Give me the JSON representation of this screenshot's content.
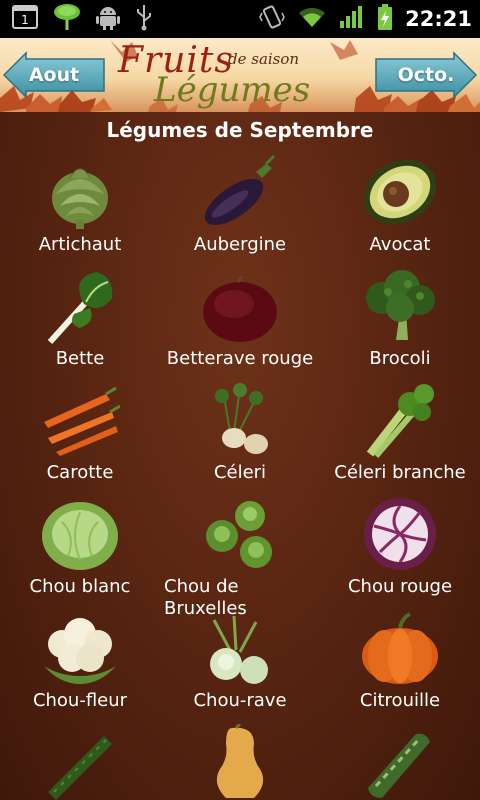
{
  "status_bar": {
    "time": "22:21",
    "notification_count": "1",
    "left_icons": [
      "notification-badge-icon",
      "plant-icon",
      "android-icon",
      "usb-icon"
    ],
    "right_icons": [
      "vibrate-icon",
      "wifi-icon",
      "signal-icon",
      "battery-charging-icon"
    ]
  },
  "header": {
    "logo_line1": "Fruits",
    "logo_small": "de saison",
    "logo_line2": "Légumes",
    "prev_label": "Aout",
    "next_label": "Octo.",
    "accent_color": "#4a9fb3"
  },
  "main": {
    "title": "Légumes de Septembre",
    "items": [
      {
        "label": "Artichaut",
        "icon": "artichoke-icon"
      },
      {
        "label": "Aubergine",
        "icon": "eggplant-icon"
      },
      {
        "label": "Avocat",
        "icon": "avocado-icon"
      },
      {
        "label": "Bette",
        "icon": "chard-icon"
      },
      {
        "label": "Betterave rouge",
        "icon": "beetroot-icon"
      },
      {
        "label": "Brocoli",
        "icon": "broccoli-icon"
      },
      {
        "label": "Carotte",
        "icon": "carrot-icon"
      },
      {
        "label": "Céleri",
        "icon": "celeriac-icon"
      },
      {
        "label": "Céleri branche",
        "icon": "celery-icon"
      },
      {
        "label": "Chou blanc",
        "icon": "white-cabbage-icon"
      },
      {
        "label": "Chou de Bruxelles",
        "icon": "brussels-sprouts-icon"
      },
      {
        "label": "Chou rouge",
        "icon": "red-cabbage-icon"
      },
      {
        "label": "Chou-fleur",
        "icon": "cauliflower-icon"
      },
      {
        "label": "Chou-rave",
        "icon": "kohlrabi-icon"
      },
      {
        "label": "Citrouille",
        "icon": "pumpkin-icon"
      },
      {
        "label": "",
        "icon": "cucumber-icon"
      },
      {
        "label": "",
        "icon": "butternut-squash-icon"
      },
      {
        "label": "",
        "icon": "zucchini-icon"
      }
    ]
  }
}
